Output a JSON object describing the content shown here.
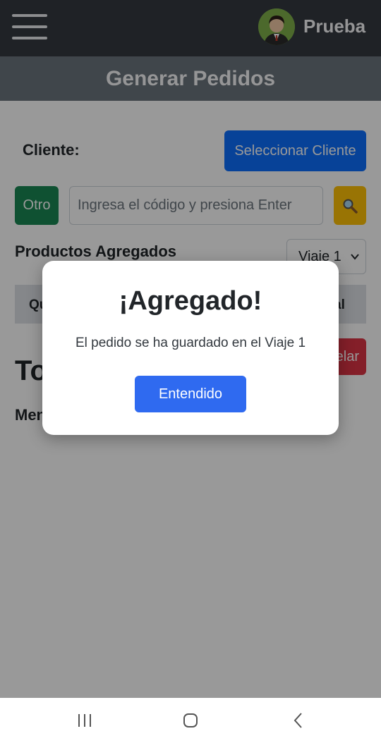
{
  "header": {
    "username": "Prueba",
    "menu_icon": "hamburger-menu-icon",
    "avatar_icon": "user-avatar"
  },
  "page": {
    "title": "Generar Pedidos"
  },
  "form": {
    "cliente_label": "Cliente:",
    "select_client_label": "Seleccionar Cliente",
    "otro_label": "Otro",
    "code_input": {
      "value": "",
      "placeholder": "Ingresa el código y presiona Enter"
    },
    "search_icon": "magnifier-icon",
    "productos_label": "Productos Agregados",
    "viaje_selected": "Viaje 1"
  },
  "table": {
    "headers_visible": [
      "Qu",
      "al"
    ]
  },
  "summary": {
    "total_label": "To",
    "cancel_label": "elar",
    "mensaje_label": "Men"
  },
  "modal": {
    "title": "¡Agregado!",
    "message": "El pedido se ha guardado en el Viaje 1",
    "button_label": "Entendido"
  },
  "colors": {
    "primary": "#0d6efd",
    "success": "#198754",
    "warning": "#ffc107",
    "danger": "#dc3545",
    "dark": "#343a40",
    "secondary": "#6c757d"
  },
  "system_nav": {
    "recents_icon": "recent-apps-icon",
    "home_icon": "home-icon",
    "back_icon": "back-icon"
  }
}
